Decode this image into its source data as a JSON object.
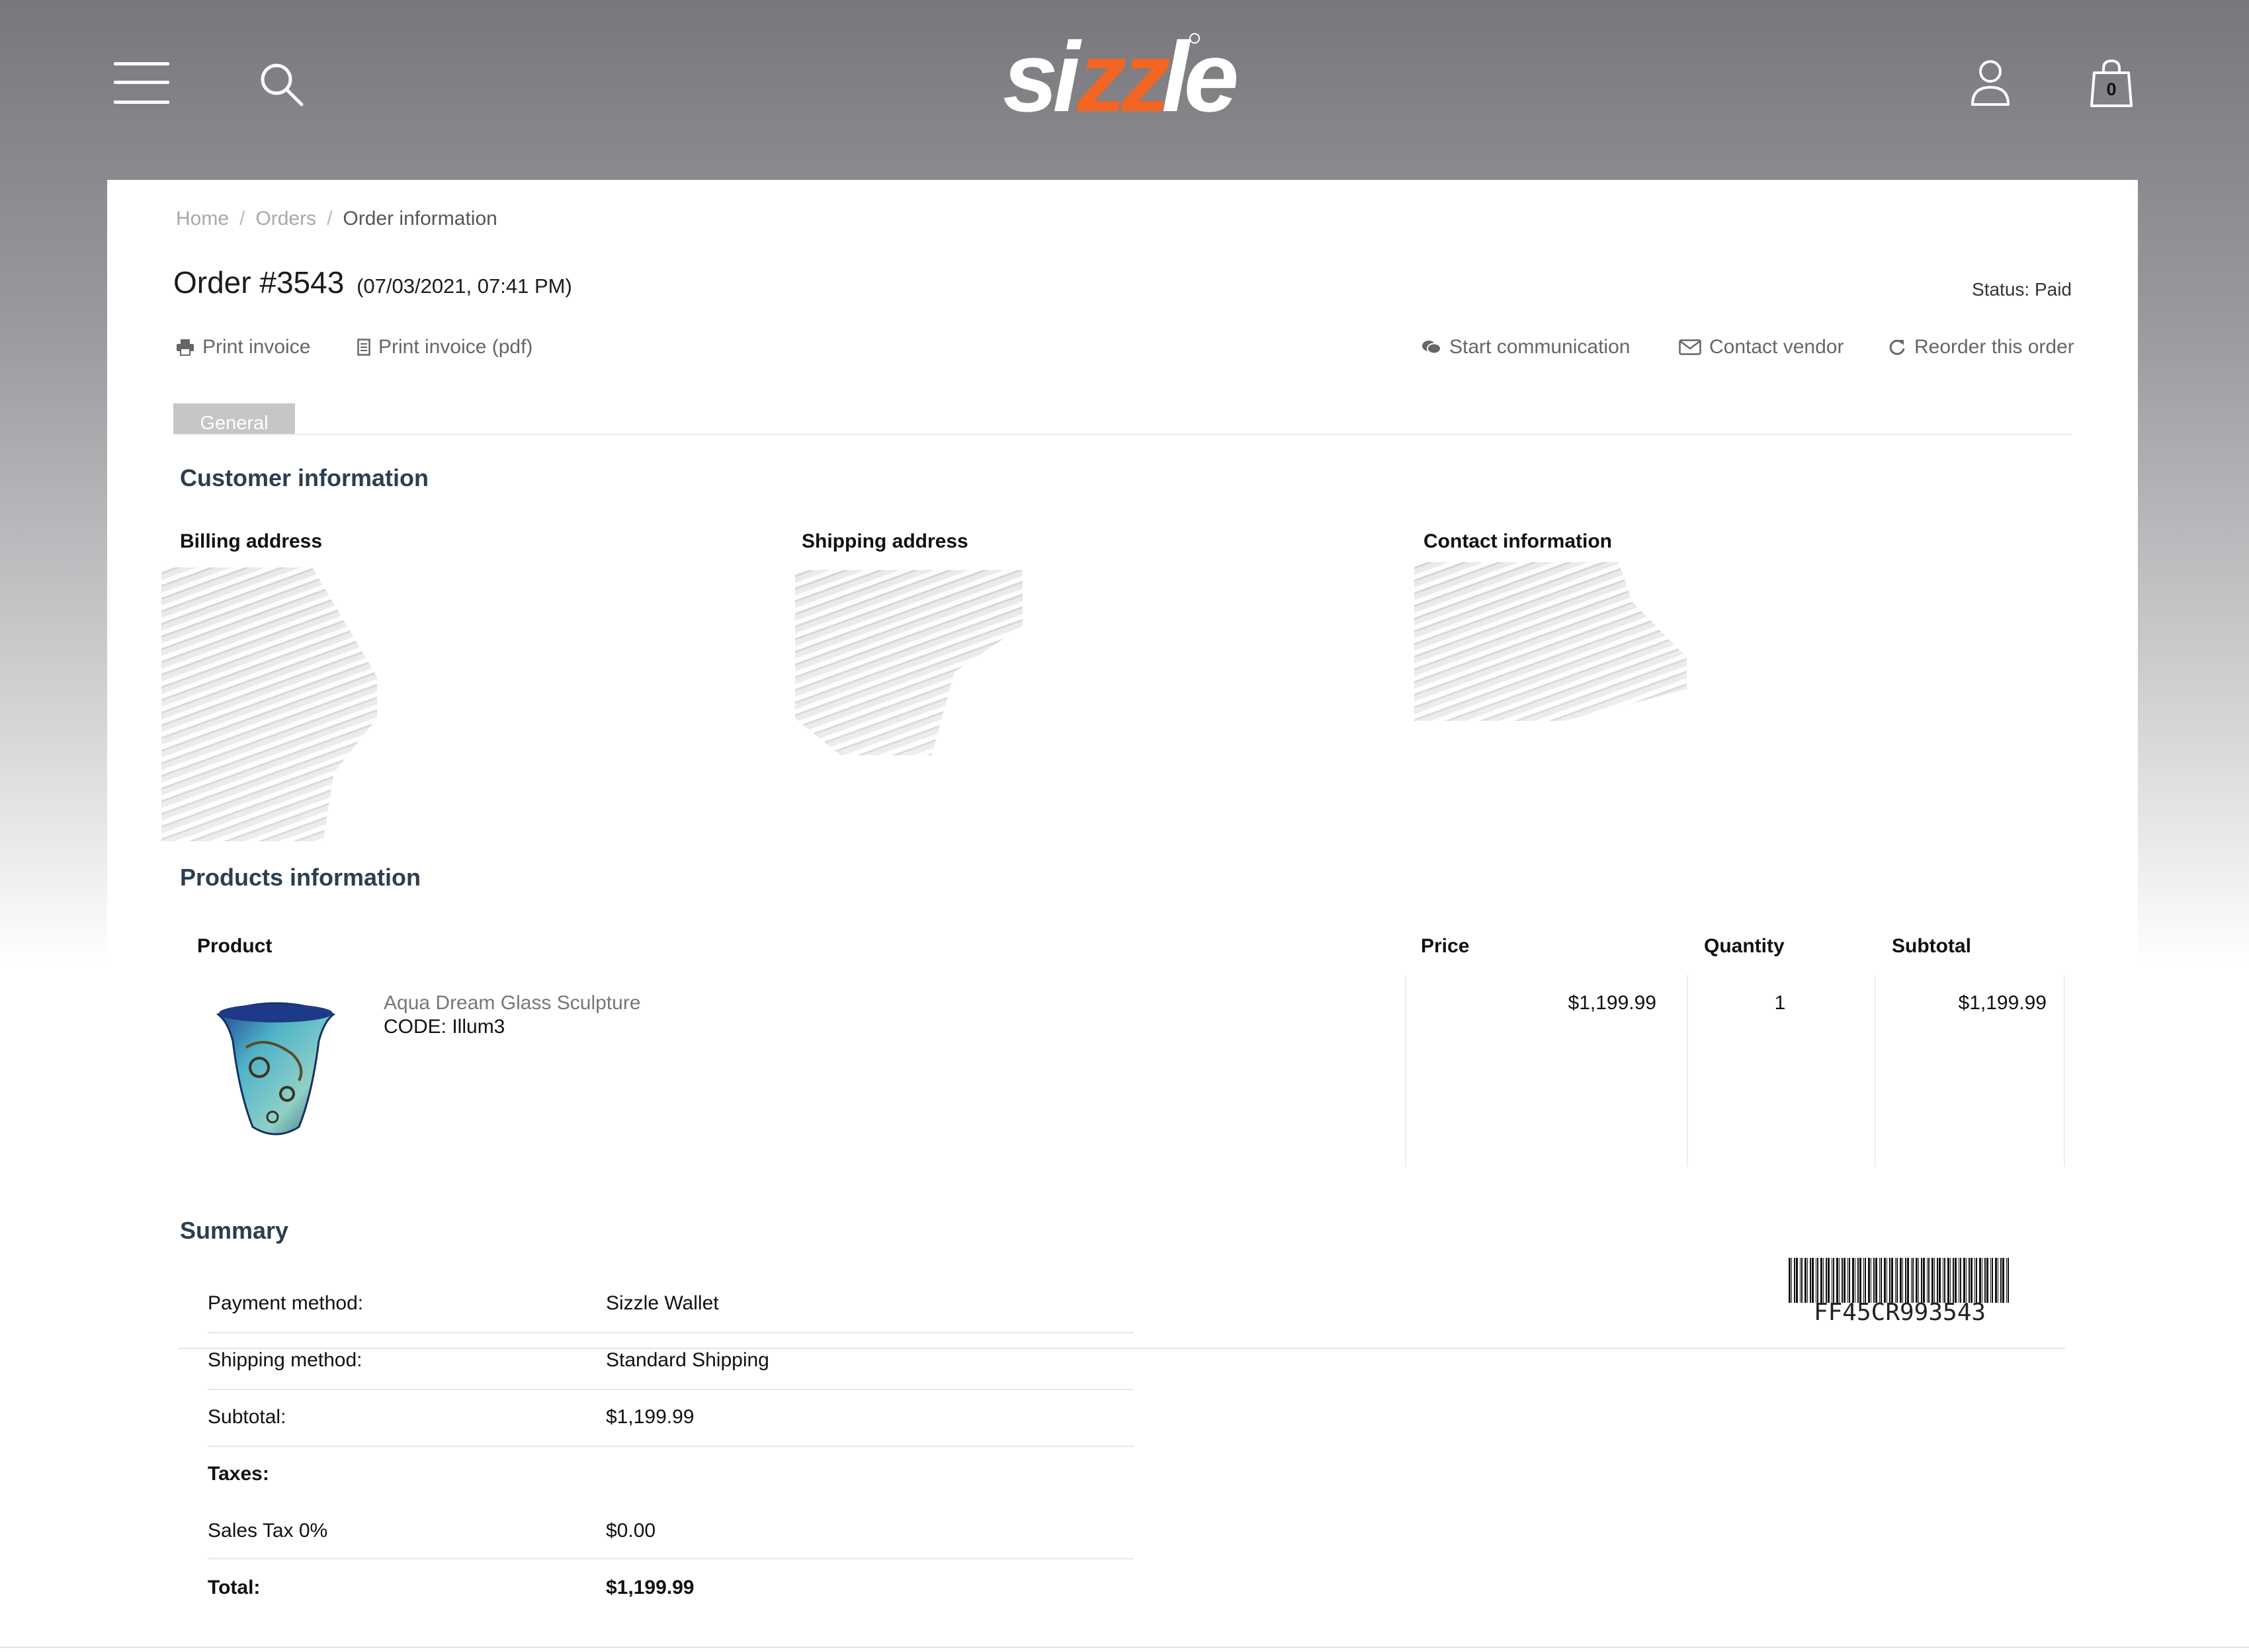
{
  "header": {
    "logo_text": "sizzle",
    "cart_count": "0"
  },
  "breadcrumb": {
    "items": [
      "Home",
      "Orders",
      "Order information"
    ],
    "separator": "/"
  },
  "order": {
    "title": "Order #3543",
    "datetime": "(07/03/2021, 07:41 PM)",
    "status": "Status: Paid"
  },
  "actions": {
    "print_invoice": "Print invoice",
    "print_invoice_pdf": "Print invoice (pdf)",
    "start_communication": "Start communication",
    "contact_vendor": "Contact vendor",
    "reorder": "Reorder this order"
  },
  "tabs": [
    {
      "label": "General"
    }
  ],
  "customer": {
    "heading": "Customer information",
    "billing_heading": "Billing address",
    "shipping_heading": "Shipping address",
    "contact_heading": "Contact information"
  },
  "products": {
    "heading": "Products information",
    "columns": [
      "Product",
      "Price",
      "Quantity",
      "Subtotal"
    ],
    "rows": [
      {
        "name": "Aqua Dream Glass Sculpture",
        "code": "CODE: Illum3",
        "price": "$1,199.99",
        "quantity": "1",
        "subtotal": "$1,199.99"
      }
    ]
  },
  "summary": {
    "heading": "Summary",
    "payment_label": "Payment method:",
    "payment_value": "Sizzle Wallet",
    "shipping_label": "Shipping method:",
    "shipping_value": "Standard Shipping",
    "subtotal_label": "Subtotal:",
    "subtotal_value": "$1,199.99",
    "taxes_label": "Taxes:",
    "tax_label": "Sales Tax 0%",
    "tax_value": "$0.00",
    "total_label": "Total:",
    "total_value": "$1,199.99"
  },
  "barcode": {
    "code": "FF45CR993543"
  },
  "colors": {
    "accent_orange": "#f26522",
    "heading": "#2c3e50",
    "header_gray": "#78777c"
  }
}
